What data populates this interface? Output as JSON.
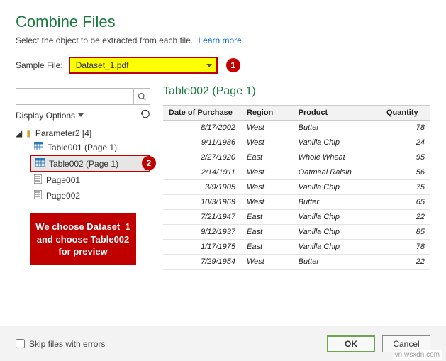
{
  "header": {
    "title": "Combine Files",
    "subtitle": "Select the object to be extracted from each file.",
    "learn_more": "Learn more"
  },
  "sample_file": {
    "label": "Sample File:",
    "value": "Dataset_1.pdf",
    "badge": "1"
  },
  "search": {
    "placeholder": ""
  },
  "display_options": {
    "label": "Display Options"
  },
  "tree": {
    "root": "Parameter2 [4]",
    "items": [
      {
        "label": "Table001 (Page 1)",
        "type": "table"
      },
      {
        "label": "Table002 (Page 1)",
        "type": "table",
        "selected": true,
        "badge": "2"
      },
      {
        "label": "Page001",
        "type": "page"
      },
      {
        "label": "Page002",
        "type": "page"
      }
    ]
  },
  "annotation": "We choose Dataset_1 and choose Table002 for preview",
  "preview": {
    "title": "Table002 (Page 1)",
    "columns": [
      "Date of Purchase",
      "Region",
      "Product",
      "Quantity"
    ],
    "rows": [
      [
        "8/17/2002",
        "West",
        "Butter",
        "78"
      ],
      [
        "9/11/1986",
        "West",
        "Vanilla Chip",
        "24"
      ],
      [
        "2/27/1920",
        "East",
        "Whole Wheat",
        "95"
      ],
      [
        "2/14/1911",
        "West",
        "Oatmeal Raisin",
        "56"
      ],
      [
        "3/9/1905",
        "West",
        "Vanilla Chip",
        "75"
      ],
      [
        "10/3/1969",
        "West",
        "Butter",
        "65"
      ],
      [
        "7/21/1947",
        "East",
        "Vanilla Chip",
        "22"
      ],
      [
        "9/12/1937",
        "East",
        "Vanilla Chip",
        "85"
      ],
      [
        "1/17/1975",
        "East",
        "Vanilla Chip",
        "78"
      ],
      [
        "7/29/1954",
        "West",
        "Butter",
        "22"
      ]
    ]
  },
  "footer": {
    "skip_label": "Skip files with errors",
    "ok": "OK",
    "cancel": "Cancel"
  },
  "watermark": "vn.wsxdn.com",
  "chart_data": {
    "type": "table",
    "title": "Table002 (Page 1)",
    "columns": [
      "Date of Purchase",
      "Region",
      "Product",
      "Quantity"
    ],
    "rows": [
      [
        "8/17/2002",
        "West",
        "Butter",
        78
      ],
      [
        "9/11/1986",
        "West",
        "Vanilla Chip",
        24
      ],
      [
        "2/27/1920",
        "East",
        "Whole Wheat",
        95
      ],
      [
        "2/14/1911",
        "West",
        "Oatmeal Raisin",
        56
      ],
      [
        "3/9/1905",
        "West",
        "Vanilla Chip",
        75
      ],
      [
        "10/3/1969",
        "West",
        "Butter",
        65
      ],
      [
        "7/21/1947",
        "East",
        "Vanilla Chip",
        22
      ],
      [
        "9/12/1937",
        "East",
        "Vanilla Chip",
        85
      ],
      [
        "1/17/1975",
        "East",
        "Vanilla Chip",
        78
      ],
      [
        "7/29/1954",
        "West",
        "Butter",
        22
      ]
    ]
  }
}
